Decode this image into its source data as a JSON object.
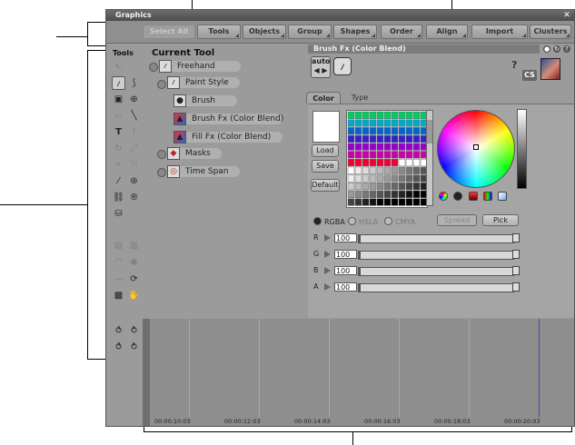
{
  "window": {
    "title": "Graphics",
    "close": "✕"
  },
  "toolbar": {
    "buttons": [
      {
        "label": "Select All",
        "enabled": false
      },
      {
        "label": "Tools",
        "enabled": true
      },
      {
        "label": "Objects",
        "enabled": true
      },
      {
        "label": "Group",
        "enabled": true
      },
      {
        "label": "Shapes",
        "enabled": true
      },
      {
        "label": "Order",
        "enabled": true
      },
      {
        "label": "Align",
        "enabled": true
      },
      {
        "label": "Import",
        "enabled": true
      },
      {
        "label": "Clusters",
        "enabled": true
      }
    ]
  },
  "tools_panel": {
    "label": "Tools",
    "icons": [
      "pointer-icon",
      "transform-icon",
      "brush-icon",
      "bezier-icon",
      "rectangle-icon",
      "ellipse-icon",
      "eraser-icon",
      "line-icon",
      "text-icon",
      "text-vertical-icon",
      "rotate-icon",
      "scale-icon",
      "crop-icon",
      "pan-icon",
      "eyedropper-icon",
      "target-icon",
      "link-icon",
      "registered-icon",
      "bucket-icon",
      "lock-icon",
      "unlock-icon",
      "visibility-icon",
      "eye-icon",
      "minus-icon",
      "refresh-icon",
      "stamp-icon",
      "hand-icon",
      "onion-prev-icon",
      "onion-next-icon",
      "onion-back-icon",
      "onion-forward-icon"
    ]
  },
  "current_tool": {
    "title": "Current Tool",
    "nodes": [
      {
        "label": "Freehand",
        "icon": "freehand-icon"
      },
      {
        "label": "Paint Style",
        "icon": "paint-style-icon"
      },
      {
        "label": "Brush",
        "icon": "brush-dot-icon"
      },
      {
        "label": "Brush Fx (Color Blend)",
        "icon": "brush-fx-icon"
      },
      {
        "label": "Fill Fx (Color Blend)",
        "icon": "fill-fx-icon"
      },
      {
        "label": "Masks",
        "icon": "masks-icon"
      },
      {
        "label": "Time Span",
        "icon": "time-span-icon"
      }
    ]
  },
  "panel": {
    "header": "Brush Fx (Color Blend)",
    "auto_label": "auto",
    "auto_arrows": "◀ ▶",
    "help": "?",
    "cs": "CS",
    "tabs": {
      "color": "Color",
      "type": "Type"
    },
    "buttons": {
      "load": "Load",
      "save": "Save",
      "default": "Default"
    },
    "color_modes": [
      {
        "label": "RGBA",
        "selected": true
      },
      {
        "label": "HSLA",
        "selected": false
      },
      {
        "label": "CMYA",
        "selected": false
      }
    ],
    "spread": "Spread",
    "pick": "Pick",
    "channels": [
      {
        "label": "R",
        "value": "100",
        "fill": "#e03030"
      },
      {
        "label": "G",
        "value": "100",
        "fill": "#30a030"
      },
      {
        "label": "B",
        "value": "100",
        "fill": "#3050d0"
      },
      {
        "label": "A",
        "value": "100",
        "fill": "#777777"
      }
    ]
  },
  "timeline": {
    "ticks": [
      "00:00:10:03",
      "00:00:12:03",
      "00:00:14:03",
      "00:00:16:03",
      "00:00:18:03",
      "00:00:20:03"
    ],
    "onion_icons": [
      "onion-prev-icon",
      "onion-next-icon",
      "onion-back-icon",
      "onion-forward-icon"
    ]
  },
  "colors": {
    "window_bg": "#9b9b9b",
    "titlebar": "#5a5a5a",
    "playhead": "#3a4fb0"
  }
}
